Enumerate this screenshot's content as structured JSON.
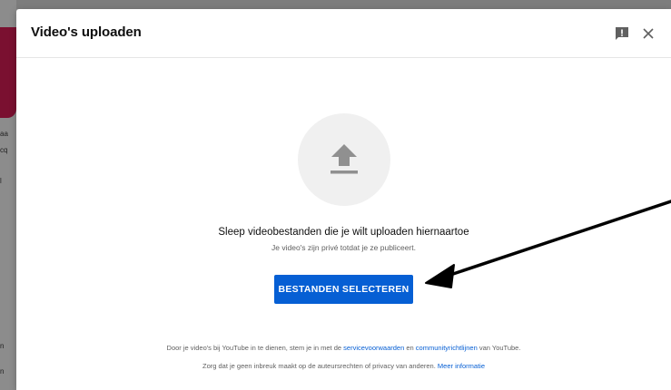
{
  "background": {
    "side_text_1": "aa",
    "side_text_2": "cq",
    "side_text_3": "l",
    "side_text_4": "n",
    "side_text_5": "n"
  },
  "dialog": {
    "title": "Video's uploaden",
    "feedback_icon": "feedback-icon",
    "close_icon": "close-icon"
  },
  "upload": {
    "icon": "upload-arrow-icon",
    "main_text": "Sleep videobestanden die je wilt uploaden hiernaartoe",
    "sub_text": "Je video's zijn privé totdat je ze publiceert.",
    "button_label": "BESTANDEN SELECTEREN"
  },
  "footer": {
    "line1_prefix": "Door je video's bij YouTube in te dienen, stem je in met de ",
    "line1_link1": "servicevoorwaarden",
    "line1_mid": " en ",
    "line1_link2": "communityrichtlijnen",
    "line1_suffix": " van YouTube.",
    "line2_prefix": "Zorg dat je geen inbreuk maakt op de auteursrechten of privacy van anderen. ",
    "line2_link": "Meer informatie"
  },
  "colors": {
    "accent": "#065fd4",
    "annotation_arrow": "#000000"
  }
}
